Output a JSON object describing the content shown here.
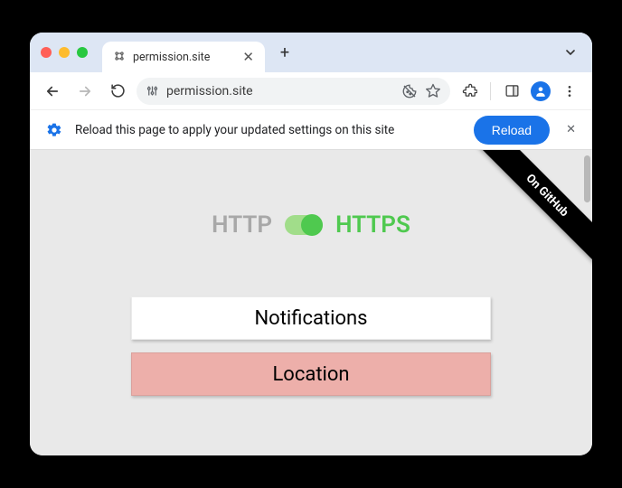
{
  "tab": {
    "title": "permission.site"
  },
  "omnibox": {
    "url": "permission.site"
  },
  "infobar": {
    "message": "Reload this page to apply your updated settings on this site",
    "reload_label": "Reload"
  },
  "ribbon": {
    "label": "On GitHub"
  },
  "protocol": {
    "http_label": "HTTP",
    "https_label": "HTTPS"
  },
  "permissions": [
    {
      "label": "Notifications",
      "status": "white"
    },
    {
      "label": "Location",
      "status": "red"
    }
  ]
}
